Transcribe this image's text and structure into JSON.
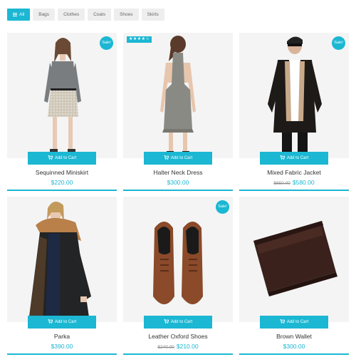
{
  "filters": [
    {
      "label": "All",
      "icon": "list-icon",
      "active": true
    },
    {
      "label": "Bags"
    },
    {
      "label": "Clothes"
    },
    {
      "label": "Coats"
    },
    {
      "label": "Shoes"
    },
    {
      "label": "Skirts"
    }
  ],
  "cart_label": "Add to Cart",
  "sale_label": "Sale!",
  "rating_stars": "★★★★☆",
  "accent_color": "#1bb7d3",
  "products": [
    {
      "name": "Sequinned Miniskirt",
      "price": "$220.00",
      "sale": true
    },
    {
      "name": "Halter Neck Dress",
      "price": "$300.00",
      "rating": 4
    },
    {
      "name": "Mixed Fabric Jacket",
      "old_price": "$650.00",
      "price": "$580.00",
      "sale": true
    },
    {
      "name": "Parka",
      "price": "$390.00"
    },
    {
      "name": "Leather Oxford Shoes",
      "old_price": "$240.00",
      "price": "$210.00",
      "sale": true
    },
    {
      "name": "Brown Wallet",
      "price": "$300.00"
    }
  ]
}
